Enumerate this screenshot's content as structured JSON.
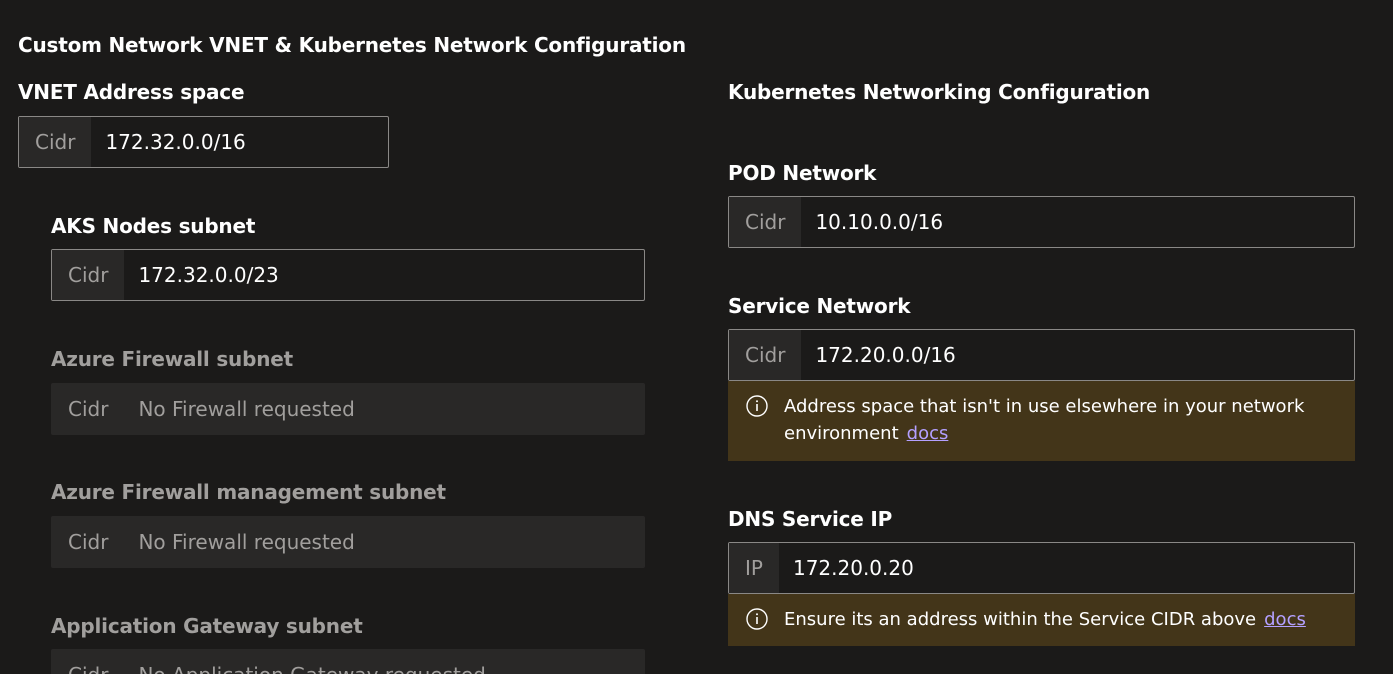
{
  "section_title": "Custom Network VNET & Kubernetes Network Configuration",
  "vnet": {
    "label": "VNET Address space",
    "prefix": "Cidr",
    "value": "172.32.0.0/16"
  },
  "subnets": {
    "aks_nodes": {
      "label": "AKS Nodes subnet",
      "prefix": "Cidr",
      "value": "172.32.0.0/23"
    },
    "firewall": {
      "label": "Azure Firewall subnet",
      "prefix": "Cidr",
      "value": "No Firewall requested"
    },
    "firewall_mgmt": {
      "label": "Azure Firewall management subnet",
      "prefix": "Cidr",
      "value": "No Firewall requested"
    },
    "app_gateway": {
      "label": "Application Gateway subnet",
      "prefix": "Cidr",
      "value": "No Application Gateway requested"
    }
  },
  "k8s": {
    "title": "Kubernetes Networking Configuration",
    "pod": {
      "label": "POD Network",
      "prefix": "Cidr",
      "value": "10.10.0.0/16"
    },
    "service": {
      "label": "Service Network",
      "prefix": "Cidr",
      "value": "172.20.0.0/16",
      "note": "Address space that isn't in use elsewhere in your network environment",
      "link": "docs"
    },
    "dns": {
      "label": "DNS Service IP",
      "prefix": "IP",
      "value": "172.20.0.20",
      "note": "Ensure its an address within the Service CIDR above",
      "link": "docs"
    }
  },
  "colors": {
    "background": "#1b1a19",
    "field_border": "#8a8886",
    "prefix_bg": "#292827",
    "warning_bg": "#433519",
    "link": "#b4a0ff"
  }
}
